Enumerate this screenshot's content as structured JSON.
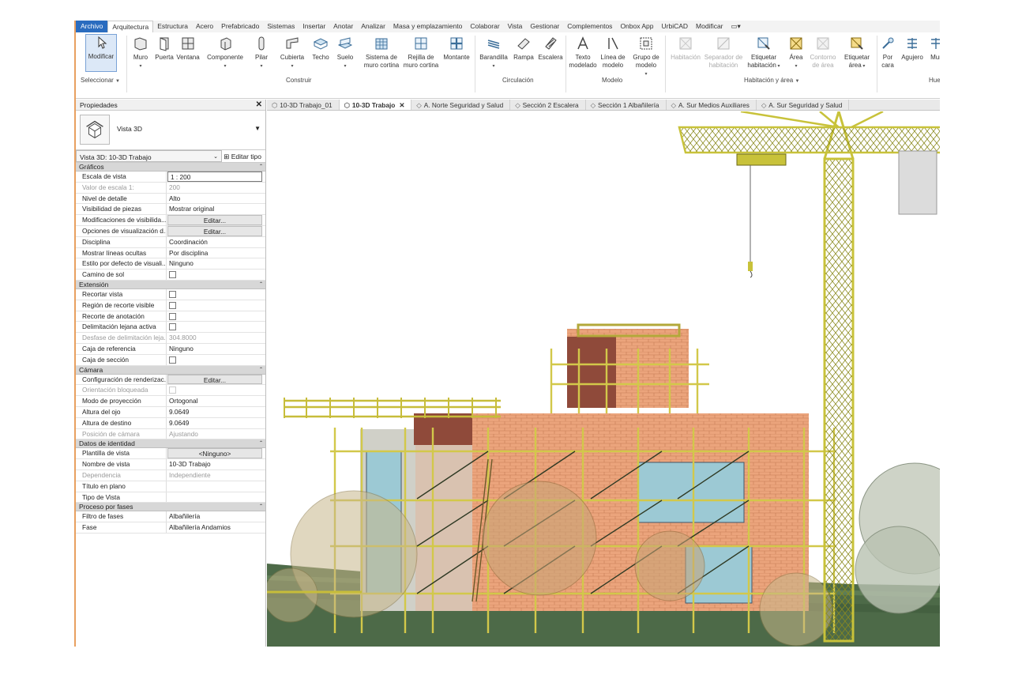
{
  "menu": {
    "tabs": [
      "Archivo",
      "Arquitectura",
      "Estructura",
      "Acero",
      "Prefabricado",
      "Sistemas",
      "Insertar",
      "Anotar",
      "Analizar",
      "Masa y emplazamiento",
      "Colaborar",
      "Vista",
      "Gestionar",
      "Complementos",
      "Onbox App",
      "UrbiCAD",
      "Modificar"
    ],
    "extra_icon": "▭▾"
  },
  "ribbon": {
    "modify": "Modificar",
    "select_panel": "Seleccionar",
    "build_panel": "Construir",
    "build": [
      "Muro",
      "Puerta",
      "Ventana",
      "Componente",
      "Pilar",
      "Cubierta",
      "Techo",
      "Suelo"
    ],
    "curtain_system": "Sistema de muro cortina",
    "curtain_grid": "Rejilla de muro cortina",
    "mullion": "Montante",
    "circulation_panel": "Circulación",
    "circulation": [
      "Barandilla",
      "Rampa",
      "Escalera"
    ],
    "model_panel": "Modelo",
    "model_text": "Texto modelado",
    "model_line": "Línea de modelo",
    "model_group": "Grupo de modelo",
    "room_panel": "Habitación y área",
    "room": "Habitación",
    "room_sep": "Separador de habitación",
    "tag_room": "Etiquetar habitación",
    "area": "Área",
    "area_boundary": "Contorno de área",
    "tag_area": "Etiquetar área",
    "by_face": "Por cara",
    "shaft": "Agujero",
    "wall_cut": "Mur",
    "openings_panel": "Hue"
  },
  "properties": {
    "title": "Propiedades",
    "type_name": "Vista 3D",
    "instance": "Vista 3D: 10-3D Trabajo",
    "edit_type": "Editar tipo",
    "groups": [
      {
        "name": "Gráficos",
        "rows": [
          {
            "k": "Escala de vista",
            "v": "1 : 200",
            "t": "input"
          },
          {
            "k": "Valor de escala    1:",
            "v": "200",
            "t": "gray"
          },
          {
            "k": "Nivel de detalle",
            "v": "Alto"
          },
          {
            "k": "Visibilidad de piezas",
            "v": "Mostrar original"
          },
          {
            "k": "Modificaciones de visibilida...",
            "v": "Editar...",
            "t": "button"
          },
          {
            "k": "Opciones de visualización d...",
            "v": "Editar...",
            "t": "button"
          },
          {
            "k": "Disciplina",
            "v": "Coordinación"
          },
          {
            "k": "Mostrar líneas ocultas",
            "v": "Por disciplina"
          },
          {
            "k": "Estilo por defecto de visuali...",
            "v": "Ninguno"
          },
          {
            "k": "Camino de sol",
            "v": "",
            "t": "check"
          }
        ]
      },
      {
        "name": "Extensión",
        "rows": [
          {
            "k": "Recortar vista",
            "v": "",
            "t": "check"
          },
          {
            "k": "Región de recorte visible",
            "v": "",
            "t": "check"
          },
          {
            "k": "Recorte de anotación",
            "v": "",
            "t": "check"
          },
          {
            "k": "Delimitación lejana activa",
            "v": "",
            "t": "check"
          },
          {
            "k": "Desfase de delimitación leja...",
            "v": "304.8000",
            "t": "gray"
          },
          {
            "k": "Caja de referencia",
            "v": "Ninguno"
          },
          {
            "k": "Caja de sección",
            "v": "",
            "t": "check"
          }
        ]
      },
      {
        "name": "Cámara",
        "rows": [
          {
            "k": "Configuración de renderizac...",
            "v": "Editar...",
            "t": "button"
          },
          {
            "k": "Orientación bloqueada",
            "v": "",
            "t": "graycheck"
          },
          {
            "k": "Modo de proyección",
            "v": "Ortogonal"
          },
          {
            "k": "Altura del ojo",
            "v": "9.0649"
          },
          {
            "k": "Altura de destino",
            "v": "9.0649"
          },
          {
            "k": "Posición de cámara",
            "v": "Ajustando",
            "t": "gray"
          }
        ]
      },
      {
        "name": "Datos de identidad",
        "rows": [
          {
            "k": "Plantilla de vista",
            "v": "<Ninguno>",
            "t": "button"
          },
          {
            "k": "Nombre de vista",
            "v": "10-3D Trabajo"
          },
          {
            "k": "Dependencia",
            "v": "Independiente",
            "t": "gray"
          },
          {
            "k": "Título en plano",
            "v": ""
          },
          {
            "k": "Tipo de Vista",
            "v": ""
          }
        ]
      },
      {
        "name": "Proceso por fases",
        "rows": [
          {
            "k": "Filtro de fases",
            "v": "Albañilería"
          },
          {
            "k": "Fase",
            "v": "Albañilería Andamios"
          }
        ]
      }
    ]
  },
  "view_tabs": [
    {
      "label": "10-3D Trabajo_01",
      "active": false
    },
    {
      "label": "10-3D Trabajo",
      "active": true
    },
    {
      "label": "A. Norte Seguridad y Salud",
      "active": false
    },
    {
      "label": "Sección 2 Escalera",
      "active": false
    },
    {
      "label": "Sección 1 Albañilería",
      "active": false
    },
    {
      "label": "A. Sur Medios Auxiliares",
      "active": false
    },
    {
      "label": "A. Sur Seguridad y Salud",
      "active": false
    }
  ],
  "colors": {
    "accent": "#2a6cbf",
    "brick": "#e8a27a",
    "scaffold": "#d2c84a",
    "crane": "#c8c23a",
    "ground": "#4d6a48",
    "glass": "#9cc9d4"
  }
}
